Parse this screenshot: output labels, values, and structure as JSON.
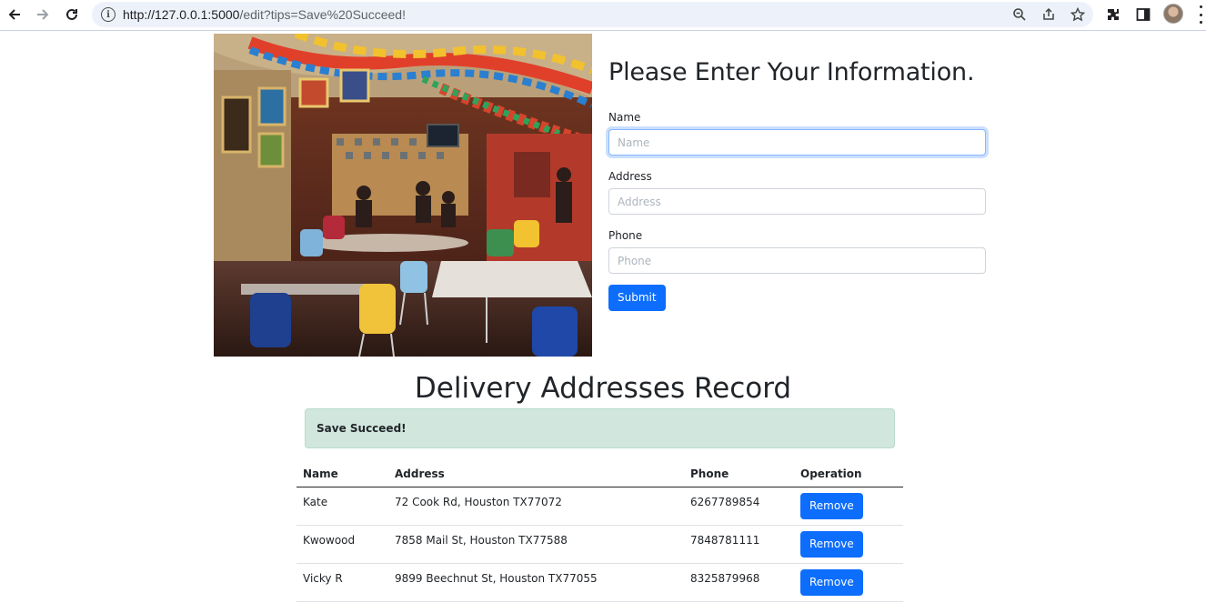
{
  "browser": {
    "url_host": "http://127.0.0.1:5000",
    "url_path": "/edit?tips=Save%20Succeed!"
  },
  "form": {
    "title": "Please Enter Your Information.",
    "fields": [
      {
        "label": "Name",
        "placeholder": "Name",
        "value": ""
      },
      {
        "label": "Address",
        "placeholder": "Address",
        "value": ""
      },
      {
        "label": "Phone",
        "placeholder": "Phone",
        "value": ""
      }
    ],
    "submit_label": "Submit"
  },
  "records": {
    "title": "Delivery Addresses Record",
    "alert": "Save Succeed!",
    "headers": [
      "Name",
      "Address",
      "Phone",
      "Operation"
    ],
    "rows": [
      {
        "name": "Kate",
        "address": "72 Cook Rd, Houston TX77072",
        "phone": "6267789854",
        "action": "Remove"
      },
      {
        "name": "Kwowood",
        "address": "7858 Mail St, Houston TX77588",
        "phone": "7848781111",
        "action": "Remove"
      },
      {
        "name": "Vicky R",
        "address": "9899 Beechnut St, Houston TX77055",
        "phone": "8325879968",
        "action": "Remove"
      }
    ]
  },
  "colors": {
    "primary": "#0d6efd",
    "alert_bg": "#d1e7dd"
  }
}
